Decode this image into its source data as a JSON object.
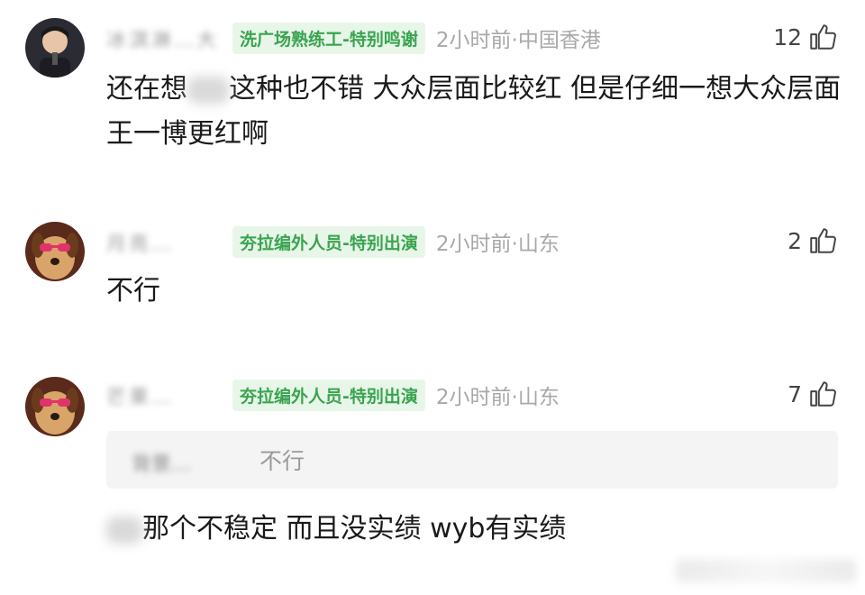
{
  "comments": [
    {
      "username": "冰淇淋…大",
      "badge": "洗广场熟练工-特别鸣谢",
      "time": "2小时前",
      "location": "中国香港",
      "likes": "12",
      "text_before": "还在想",
      "text_after": "这种也不错 大众层面比较红 但是仔细一想大众层面王一博更红啊"
    },
    {
      "username": "月亮…",
      "badge": "夯拉编外人员-特别出演",
      "time": "2小时前",
      "location": "山东",
      "likes": "2",
      "text": "不行"
    },
    {
      "username": "芒果…",
      "badge": "夯拉编外人员-特别出演",
      "time": "2小时前",
      "location": "山东",
      "likes": "7",
      "reply_to_user": "背景…",
      "reply_to_text": "不行",
      "text": "那个不稳定 而且没实绩 wyb有实绩"
    }
  ],
  "icons": {
    "like": "thumbs-up-icon",
    "separator": "·"
  },
  "colors": {
    "badge_bg": "#e7f6e8",
    "badge_fg": "#3aa450",
    "meta": "#a8a8a8"
  }
}
